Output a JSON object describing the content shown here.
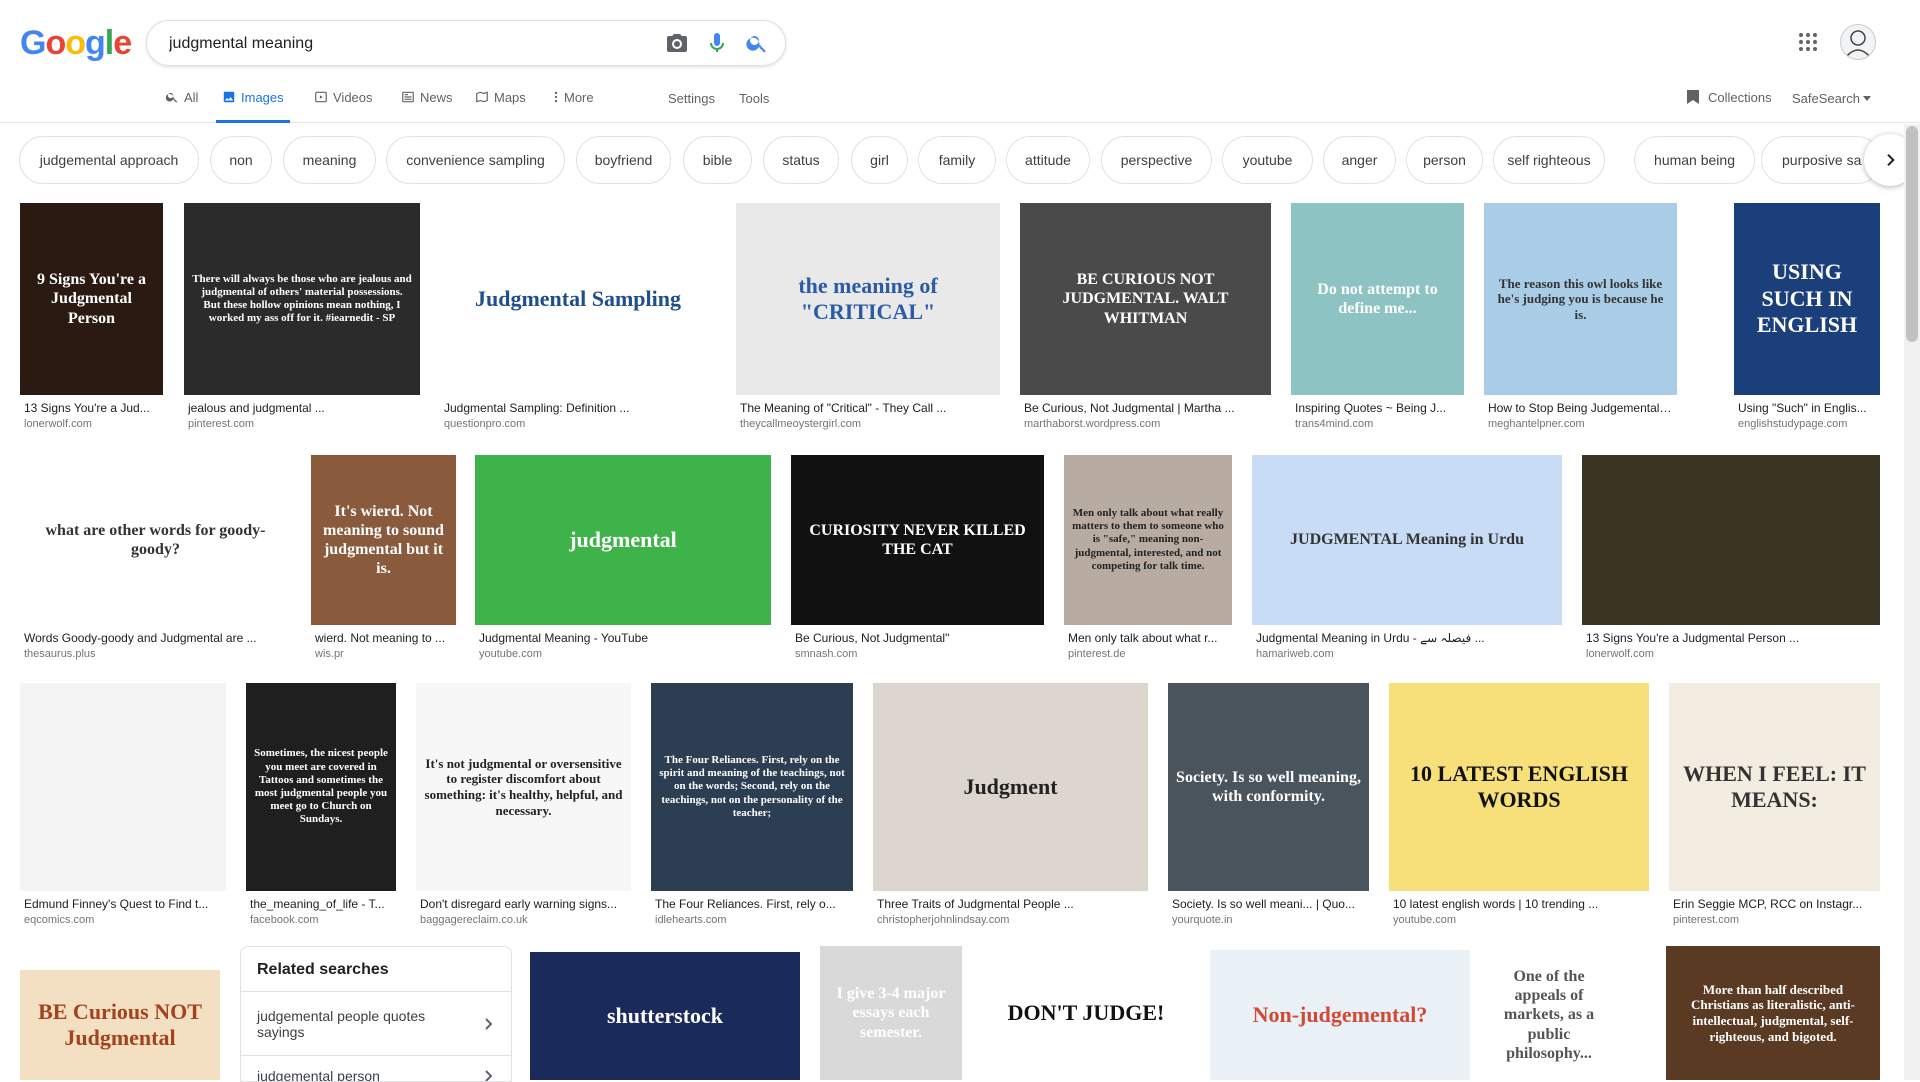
{
  "search": {
    "query": "judgmental meaning"
  },
  "logo": "Google",
  "tabs": [
    {
      "label": "All",
      "icon": "search-icon",
      "active": false
    },
    {
      "label": "Images",
      "icon": "image-icon",
      "active": true
    },
    {
      "label": "Videos",
      "icon": "video-icon",
      "active": false
    },
    {
      "label": "News",
      "icon": "news-icon",
      "active": false
    },
    {
      "label": "Maps",
      "icon": "map-icon",
      "active": false
    },
    {
      "label": "More",
      "icon": "more-vert-icon",
      "active": false
    }
  ],
  "tools": {
    "settings": "Settings",
    "tools": "Tools",
    "collections": "Collections",
    "safesearch": "SafeSearch"
  },
  "chips": [
    "judgemental approach",
    "non",
    "meaning",
    "convenience sampling",
    "boyfriend",
    "bible",
    "status",
    "girl",
    "family",
    "attitude",
    "perspective",
    "youtube",
    "anger",
    "person",
    "self righteous",
    "human being",
    "purposive sa"
  ],
  "results": [
    {
      "title": "13 Signs You're a Jud...",
      "source": "lonerwolf.com",
      "caption": "9 Signs You're a Judgmental Person",
      "bg": "#2a1a12",
      "fg": "#ffffff"
    },
    {
      "title": "jealous and judgmental ...",
      "source": "pinterest.com",
      "caption": "There will always be those who are jealous and judgmental of others' material possessions. But these hollow opinions mean nothing, I worked my ass off for it. #iearnedit - SP",
      "bg": "#2b2b2b",
      "fg": "#ffffff"
    },
    {
      "title": "Judgmental Sampling: Definition ...",
      "source": "questionpro.com",
      "caption": "Judgmental Sampling",
      "bg": "#ffffff",
      "fg": "#1f4e8c"
    },
    {
      "title": "The Meaning of \"Critical\" - They Call ...",
      "source": "theycallmeoystergirl.com",
      "caption": "the meaning of \"CRITICAL\"",
      "bg": "#e9e9e9",
      "fg": "#2a5aa8"
    },
    {
      "title": "Be Curious, Not Judgmental | Martha ...",
      "source": "marthaborst.wordpress.com",
      "caption": "BE CURIOUS NOT JUDGMENTAL. WALT WHITMAN",
      "bg": "#4a4a4a",
      "fg": "#ffffff"
    },
    {
      "title": "Inspiring Quotes ~ Being J...",
      "source": "trans4mind.com",
      "caption": "Do not attempt to define me...",
      "bg": "#8ec3c4",
      "fg": "#ffffff"
    },
    {
      "title": "How to Stop Being Judgemental and ...",
      "source": "meghantelpner.com",
      "caption": "The reason this owl looks like he's judging you is because he is.",
      "bg": "#a9cde6",
      "fg": "#333333"
    },
    {
      "title": "Using \"Such\" in Englis...",
      "source": "englishstudypage.com",
      "caption": "USING SUCH IN ENGLISH",
      "bg": "#1a3f7a",
      "fg": "#ffffff"
    },
    {
      "title": "Words Goody-goody and Judgmental are ...",
      "source": "thesaurus.plus",
      "caption": "what are other words for goody-goody?",
      "bg": "#ffffff",
      "fg": "#333333"
    },
    {
      "title": "wierd. Not meaning to ...",
      "source": "wis.pr",
      "caption": "It's wierd. Not meaning to sound judgmental but it is.",
      "bg": "#8a5a3c",
      "fg": "#ffffff"
    },
    {
      "title": "Judgmental Meaning - YouTube",
      "source": "youtube.com",
      "caption": "judgmental",
      "bg": "#3db34a",
      "fg": "#ffffff"
    },
    {
      "title": "Be Curious, Not Judgmental\"",
      "source": "smnash.com",
      "caption": "CURIOSITY NEVER KILLED THE CAT",
      "bg": "#111111",
      "fg": "#ffffff"
    },
    {
      "title": "Men only talk about what r...",
      "source": "pinterest.de",
      "caption": "Men only talk about what really matters to them to someone who is \"safe,\" meaning non-judgmental, interested, and not competing for talk time.",
      "bg": "#b8aca2",
      "fg": "#222222"
    },
    {
      "title": "Judgmental Meaning in Urdu - فیصلہ سے ...",
      "source": "hamariweb.com",
      "caption": "JUDGMENTAL Meaning in Urdu",
      "bg": "#c9dcf5",
      "fg": "#333333"
    },
    {
      "title": "13 Signs You're a Judgmental Person ...",
      "source": "lonerwolf.com",
      "caption": "",
      "bg": "#3a3422",
      "fg": "#ffffff"
    },
    {
      "title": "Edmund Finney's Quest to Find t...",
      "source": "eqcomics.com",
      "caption": "",
      "bg": "#f4f4f4",
      "fg": "#222222"
    },
    {
      "title": "the_meaning_of_life - T...",
      "source": "facebook.com",
      "caption": "Sometimes, the nicest people you meet are covered in Tattoos and sometimes the most judgmental people you meet go to Church on Sundays.",
      "bg": "#1f1f1f",
      "fg": "#ffffff"
    },
    {
      "title": "Don't disregard early warning signs...",
      "source": "baggagereclaim.co.uk",
      "caption": "It's not judgmental or oversensitive to register discomfort about something: it's healthy, helpful, and necessary.",
      "bg": "#f7f7f7",
      "fg": "#222222"
    },
    {
      "title": "The Four Reliances. First, rely o...",
      "source": "idlehearts.com",
      "caption": "The Four Reliances. First, rely on the spirit and meaning of the teachings, not on the words; Second, rely on the teachings, not on the personality of the teacher;",
      "bg": "#2c3e52",
      "fg": "#ffffff"
    },
    {
      "title": "Three Traits of Judgmental People ...",
      "source": "christopherjohnlindsay.com",
      "caption": "Judgment",
      "bg": "#dcd6cf",
      "fg": "#222222"
    },
    {
      "title": "Society. Is so well meani... | Quo...",
      "source": "yourquote.in",
      "caption": "Society. Is so well meaning, with conformity.",
      "bg": "#4a545c",
      "fg": "#ffffff"
    },
    {
      "title": "10 latest english words | 10 trending ...",
      "source": "youtube.com",
      "caption": "10 LATEST ENGLISH WORDS",
      "bg": "#f7e07a",
      "fg": "#111111"
    },
    {
      "title": "Erin Seggie MCP, RCC on Instagr...",
      "source": "pinterest.com",
      "caption": "WHEN I FEEL: IT MEANS:",
      "bg": "#f3ece1",
      "fg": "#333333"
    },
    {
      "title": "",
      "source": "",
      "caption": "BE Curious NOT Judgmental",
      "bg": "#f3dfc2",
      "fg": "#a2421f"
    },
    {
      "title": "",
      "source": "",
      "caption": "shutterstock",
      "bg": "#1a2a5a",
      "fg": "#ffffff"
    },
    {
      "title": "",
      "source": "",
      "caption": "I give 3-4 major essays each semester.",
      "bg": "#d9d9d9",
      "fg": "#ffffff"
    },
    {
      "title": "",
      "source": "",
      "caption": "DON'T JUDGE!",
      "bg": "#ffffff",
      "fg": "#111111"
    },
    {
      "title": "",
      "source": "",
      "caption": "Non-judgemental?",
      "bg": "#e9f1f6",
      "fg": "#d04b35"
    },
    {
      "title": "",
      "source": "",
      "caption": "One of the appeals of markets, as a public philosophy...",
      "bg": "#ffffff",
      "fg": "#555555"
    },
    {
      "title": "",
      "source": "",
      "caption": "More than half described Christians as literalistic, anti-intellectual, judgmental, self-righteous, and bigoted.",
      "bg": "#5a3a22",
      "fg": "#ffffff"
    }
  ],
  "related": {
    "heading": "Related searches",
    "items": [
      "judgemental people quotes sayings",
      "judgemental person"
    ]
  },
  "colors": {
    "accent": "#1a73e8",
    "link": "#1a0dab"
  }
}
